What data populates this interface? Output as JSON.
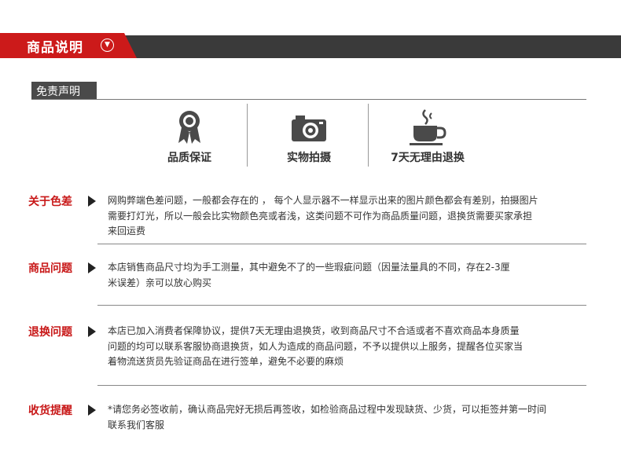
{
  "header": {
    "title": "商品说明"
  },
  "disclaimer": {
    "label": "免责声明"
  },
  "features": [
    {
      "icon": "award-ribbon-icon",
      "label": "品质保证"
    },
    {
      "icon": "camera-icon",
      "label": "实物拍摄"
    },
    {
      "icon": "coffee-cup-icon",
      "label": "7天无理由退换"
    }
  ],
  "sections": [
    {
      "title": "关于色差",
      "lines": [
        "网购弊端色差问题，一般都会存在的 ， 每个人显示器不一样显示出来的图片颜色都会有差别，拍摄图片",
        "需要打灯光，所以一般会比实物颜色亮或者浅，这类问题不可作为商品质量问题，退换货需要买家承担",
        "来回运费"
      ]
    },
    {
      "title": "商品问题",
      "lines": [
        "本店销售商品尺寸均为手工测量，其中避免不了的一些瑕疵问题（因量法量具的不同，存在2-3厘",
        "米误差）亲可以放心购买"
      ]
    },
    {
      "title": "退换问题",
      "lines": [
        "本店已加入消费者保障协议，提供7天无理由退换货，收到商品尺寸不合适或者不喜欢商品本身质量",
        "问题的均可以联系客服协商退换货，如人为造成的商品问题，不予以提供以上服务，提醒各位买家当",
        "着物流送货员先验证商品在进行签单，避免不必要的麻烦"
      ]
    },
    {
      "title": "收货提醒",
      "lines": [
        "*请您务必签收前，确认商品完好无损后再签收，如检验商品过程中发现缺货、少货，可以拒签并第一时间",
        "联系我们客服"
      ]
    }
  ]
}
